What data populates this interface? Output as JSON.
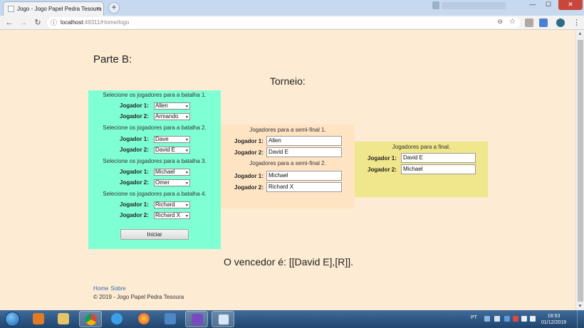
{
  "browser": {
    "tab_title": "Jogo - Jogo Papel Pedra Tesoura",
    "tab_close": "×",
    "new_tab": "+",
    "url_host": "localhost",
    "url_rest": ":49311/Home/logo",
    "window_buttons": {
      "minimize": "—",
      "maximize": "☐",
      "close": "✕"
    }
  },
  "page": {
    "parte": "Parte B:",
    "torneio": "Torneio:",
    "round1": {
      "battles": [
        {
          "caption": "Selecione os jogadores para a batalha 1.",
          "player1_label": "Jogador 1:",
          "player1": "Allen",
          "player2_label": "Jogador 2:",
          "player2": "Armando"
        },
        {
          "caption": "Selecione os jogadores para a batalha 2.",
          "player1_label": "Jogador 1:",
          "player1": "Dave",
          "player2_label": "Jogador 2:",
          "player2": "David E"
        },
        {
          "caption": "Selecione os jogadores para a batalha 3.",
          "player1_label": "Jogador 1:",
          "player1": "Michael",
          "player2_label": "Jogador 2:",
          "player2": "Omer"
        },
        {
          "caption": "Selecione os jogadores para a batalha 4.",
          "player1_label": "Jogador 1:",
          "player1": "Richard",
          "player2_label": "Jogador 2:",
          "player2": "Richard X"
        }
      ],
      "start_button": "Iniciar"
    },
    "semifinals": [
      {
        "caption": "Jogadores para a semi-final 1.",
        "player1_label": "Jogador 1:",
        "player1": "Allen",
        "player2_label": "Jogador 2:",
        "player2": "David E"
      },
      {
        "caption": "Jogadores para a semi-final 2.",
        "player1_label": "Jogador 1:",
        "player1": "Michael",
        "player2_label": "Jogador 2:",
        "player2": "Richard X"
      }
    ],
    "final": {
      "caption": "Jogadores para a final.",
      "player1_label": "Jogador 1:",
      "player1": "David E",
      "player2_label": "Jogador 2:",
      "player2": "Michael"
    },
    "winner": "O vencedor é: [[David E],[R]].",
    "footer": {
      "link_home": "Home",
      "link_about": "Sobre",
      "copyright": "© 2019 - Jogo Papel Pedra Tesoura"
    }
  },
  "taskbar": {
    "language": "PT",
    "time": "18:53",
    "date": "01/12/2019"
  },
  "colors": {
    "page_bg": "#fdebd3",
    "round1_bg": "#7fffd4",
    "semifinal_bg": "#ffe4c4",
    "final_bg": "#f0e68c",
    "link": "#3b6ab3"
  }
}
